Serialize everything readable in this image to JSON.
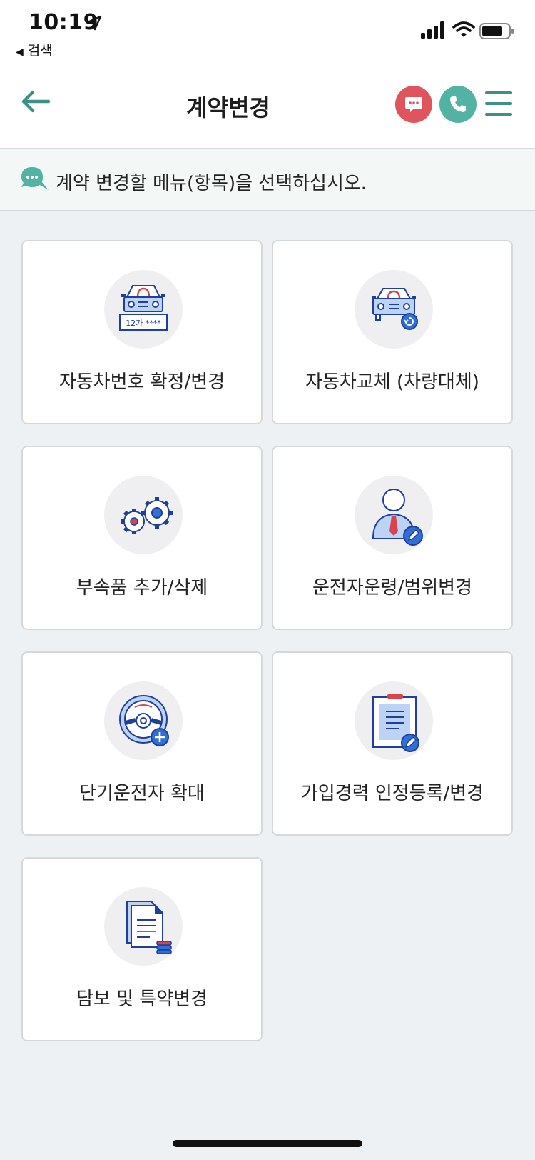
{
  "status_bar": {
    "time": "10:19",
    "back_app": "검색",
    "back_app_arrow": "◀"
  },
  "header": {
    "title": "계약변경"
  },
  "notice": {
    "text": "계약 변경할 메뉴(항목)을 선택하십시오."
  },
  "menu": {
    "items": [
      {
        "label": "자동차번호 확정/변경",
        "plate_text": "12가 ****"
      },
      {
        "label": "자동차교체 (차량대체)"
      },
      {
        "label": "부속품 추가/삭제"
      },
      {
        "label": "운전자운령/범위변경"
      },
      {
        "label": "단기운전자 확대"
      },
      {
        "label": "가입경력 인정등록/변경"
      },
      {
        "label": "담보 및 특약변경"
      }
    ]
  },
  "colors": {
    "accent_teal": "#52b2a3",
    "chat_red": "#e0545d",
    "icon_blue": "#1e3f9a",
    "icon_light_blue": "#bcd3f5",
    "icon_red": "#d9434b"
  }
}
